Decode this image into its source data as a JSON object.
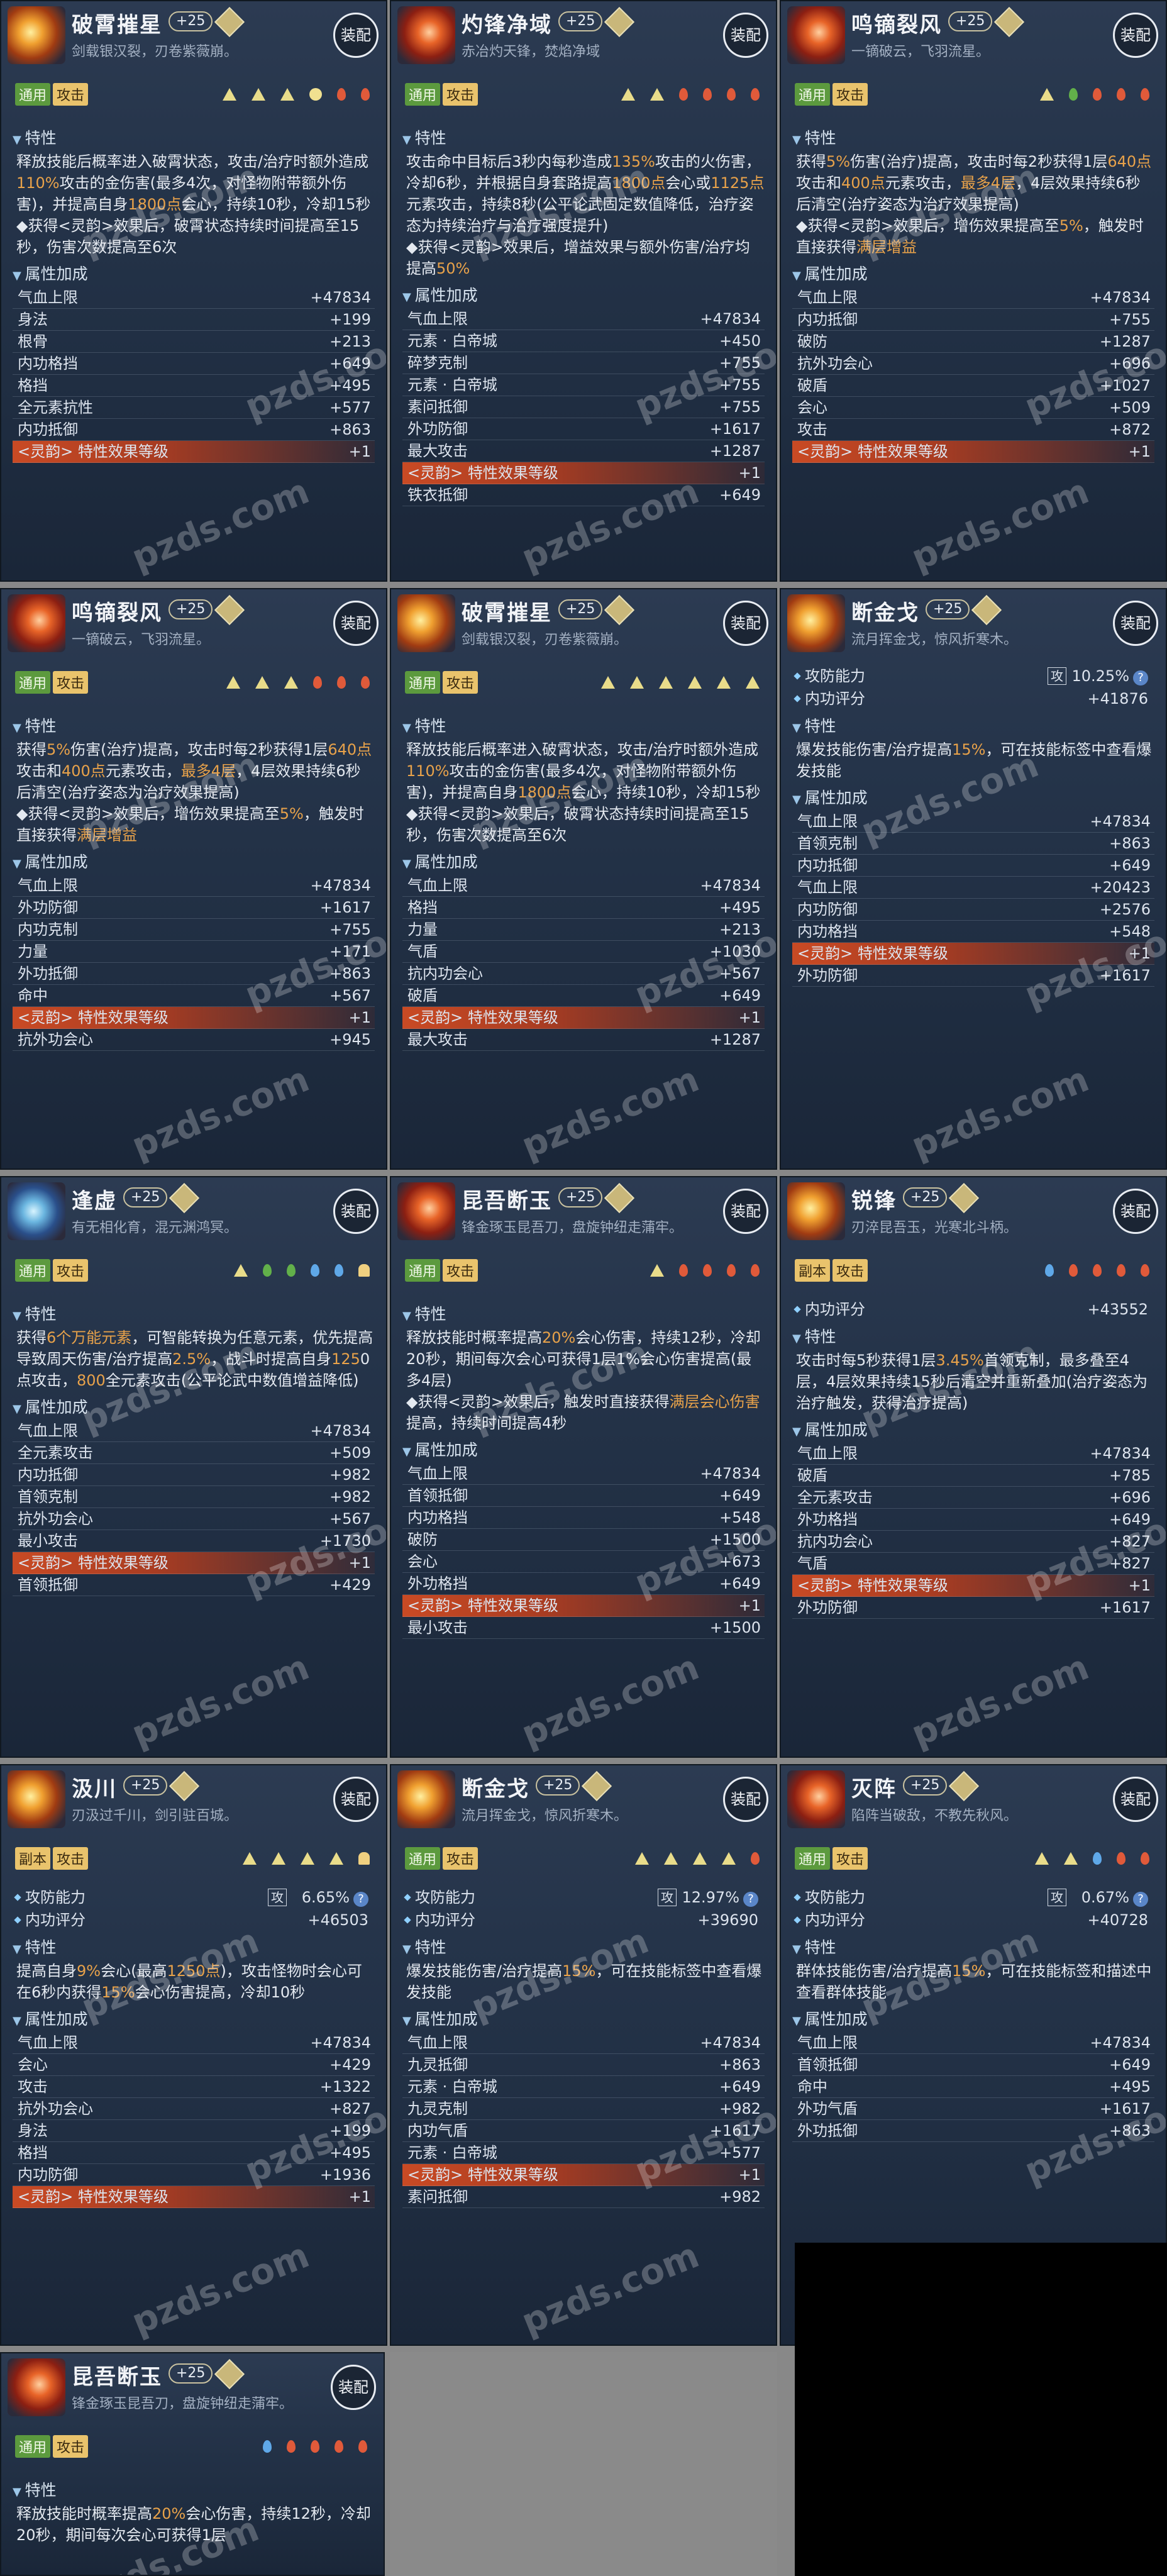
{
  "watermark": "pzds.com",
  "equip_label": "装配",
  "sections": {
    "trait": "特性",
    "attr": "属性加成"
  },
  "cards": [
    {
      "title": "破霄摧星",
      "level": "+25",
      "sub": "剑载银汉裂，刃卷紫薇崩。",
      "tags": [
        "通用",
        "攻击"
      ],
      "tagc": [
        "g",
        "y"
      ],
      "dots": [
        "tri",
        "tri",
        "tri",
        "sun",
        "red",
        "red"
      ],
      "icon": "a",
      "trait": [
        {
          "t": "释放技能后概率进入破霄状态，攻击/治疗时额外造成"
        },
        {
          "t": "110%",
          "h": 1
        },
        {
          "t": "攻击的金伤害(最多4次，对怪物附带额外伤害)，并提高自身"
        },
        {
          "t": "1800点",
          "h": 1
        },
        {
          "t": "会心，持续10秒，冷却15秒"
        },
        {
          "t": "\n◆获得<灵韵>效果后，破霄状态持续时间提高至15秒，伤害次数提高至6次"
        }
      ],
      "rows": [
        [
          "气血上限",
          "+47834"
        ],
        [
          "身法",
          "+199"
        ],
        [
          "根骨",
          "+213"
        ],
        [
          "内功格挡",
          "+649"
        ],
        [
          "格挡",
          "+495"
        ],
        [
          "全元素抗性",
          "+577"
        ],
        [
          "内功抵御",
          "+863"
        ],
        [
          "<灵韵> 特性效果等级",
          "+1",
          "s"
        ]
      ]
    },
    {
      "title": "灼锋净域",
      "level": "+25",
      "sub": "赤冶灼天锋，焚焰净域",
      "tags": [
        "通用",
        "攻击"
      ],
      "tagc": [
        "g",
        "y"
      ],
      "dots": [
        "tri",
        "tri",
        "red",
        "red",
        "red",
        "red"
      ],
      "icon": "b",
      "trait": [
        {
          "t": "攻击命中目标后3秒内每秒造成"
        },
        {
          "t": "135%",
          "h": 1
        },
        {
          "t": "攻击的火伤害，冷却6秒，并根据自身套路提高"
        },
        {
          "t": "1800点",
          "h": 1
        },
        {
          "t": "会心或"
        },
        {
          "t": "1125点",
          "h": 1
        },
        {
          "t": "元素攻击，持续8秒(公平论武固定数值降低，治疗姿态为持续治疗与治疗强度提升)"
        },
        {
          "t": "\n◆获得<灵韵>效果后，增益效果与额外伤害/治疗均提高"
        },
        {
          "t": "50%",
          "h": 1
        }
      ],
      "rows": [
        [
          "气血上限",
          "+47834"
        ],
        [
          "元素 · 白帝城",
          "+450"
        ],
        [
          "碎梦克制",
          "+755"
        ],
        [
          "元素 · 白帝城",
          "+755"
        ],
        [
          "素问抵御",
          "+755"
        ],
        [
          "外功防御",
          "+1617"
        ],
        [
          "最大攻击",
          "+1287"
        ],
        [
          "<灵韵> 特性效果等级",
          "+1",
          "s"
        ],
        [
          "铁衣抵御",
          "+649"
        ]
      ]
    },
    {
      "title": "鸣镝裂风",
      "level": "+25",
      "sub": "一镝破云，飞羽流星。",
      "tags": [
        "通用",
        "攻击"
      ],
      "tagc": [
        "g",
        "y"
      ],
      "dots": [
        "tri",
        "grn",
        "red",
        "red",
        "red"
      ],
      "icon": "b",
      "trait": [
        {
          "t": "获得"
        },
        {
          "t": "5%",
          "h": 1
        },
        {
          "t": "伤害(治疗)提高，攻击时每2秒获得1层"
        },
        {
          "t": "640点",
          "h": 1
        },
        {
          "t": "攻击和"
        },
        {
          "t": "400点",
          "h": 1
        },
        {
          "t": "元素攻击，"
        },
        {
          "t": "最多4层",
          "h": 1
        },
        {
          "t": "，4层效果持续6秒后清空(治疗姿态为治疗效果提高)"
        },
        {
          "t": "\n◆获得<灵韵>效果后，增伤效果提高至"
        },
        {
          "t": "5%",
          "h": 1
        },
        {
          "t": "，触发时直接获得"
        },
        {
          "t": "满层增益",
          "h": 1
        }
      ],
      "rows": [
        [
          "气血上限",
          "+47834"
        ],
        [
          "内功抵御",
          "+755"
        ],
        [
          "破防",
          "+1287"
        ],
        [
          "抗外功会心",
          "+696"
        ],
        [
          "破盾",
          "+1027"
        ],
        [
          "会心",
          "+509"
        ],
        [
          "攻击",
          "+872"
        ],
        [
          "<灵韵> 特性效果等级",
          "+1",
          "s"
        ]
      ]
    },
    {
      "title": "鸣镝裂风",
      "level": "+25",
      "sub": "一镝破云，飞羽流星。",
      "tags": [
        "通用",
        "攻击"
      ],
      "tagc": [
        "g",
        "y"
      ],
      "dots": [
        "tri",
        "tri",
        "tri",
        "red",
        "red",
        "red"
      ],
      "icon": "b",
      "trait": [
        {
          "t": "获得"
        },
        {
          "t": "5%",
          "h": 1
        },
        {
          "t": "伤害(治疗)提高，攻击时每2秒获得1层"
        },
        {
          "t": "640点",
          "h": 1
        },
        {
          "t": "攻击和"
        },
        {
          "t": "400点",
          "h": 1
        },
        {
          "t": "元素攻击，"
        },
        {
          "t": "最多4层",
          "h": 1
        },
        {
          "t": "，4层效果持续6秒后清空(治疗姿态为治疗效果提高)"
        },
        {
          "t": "\n◆获得<灵韵>效果后，增伤效果提高至"
        },
        {
          "t": "5%",
          "h": 1
        },
        {
          "t": "，触发时直接获得"
        },
        {
          "t": "满层增益",
          "h": 1
        }
      ],
      "rows": [
        [
          "气血上限",
          "+47834"
        ],
        [
          "外功防御",
          "+1617"
        ],
        [
          "内功克制",
          "+755"
        ],
        [
          "力量",
          "+171"
        ],
        [
          "外功抵御",
          "+863"
        ],
        [
          "命中",
          "+567"
        ],
        [
          "<灵韵> 特性效果等级",
          "+1",
          "s"
        ],
        [
          "抗外功会心",
          "+945"
        ]
      ]
    },
    {
      "title": "破霄摧星",
      "level": "+25",
      "sub": "剑载银汉裂，刃卷紫薇崩。",
      "tags": [
        "通用",
        "攻击"
      ],
      "tagc": [
        "g",
        "y"
      ],
      "dots": [
        "tri",
        "tri",
        "tri",
        "tri",
        "tri",
        "tri"
      ],
      "icon": "a",
      "trait": [
        {
          "t": "释放技能后概率进入破霄状态，攻击/治疗时额外造成"
        },
        {
          "t": "110%",
          "h": 1
        },
        {
          "t": "攻击的金伤害(最多4次，对怪物附带额外伤害)，并提高自身"
        },
        {
          "t": "1800点",
          "h": 1
        },
        {
          "t": "会心，持续10秒，冷却15秒"
        },
        {
          "t": "\n◆获得<灵韵>效果后，破霄状态持续时间提高至15秒，伤害次数提高至6次"
        }
      ],
      "rows": [
        [
          "气血上限",
          "+47834"
        ],
        [
          "格挡",
          "+495"
        ],
        [
          "力量",
          "+213"
        ],
        [
          "气盾",
          "+1030"
        ],
        [
          "抗内功会心",
          "+567"
        ],
        [
          "破盾",
          "+649"
        ],
        [
          "<灵韵> 特性效果等级",
          "+1",
          "s"
        ],
        [
          "最大攻击",
          "+1287"
        ]
      ]
    },
    {
      "title": "断金戈",
      "level": "+25",
      "sub": "流月挥金戈，惊风折寒木。",
      "tags": [],
      "tagc": [],
      "dots": [],
      "icon": "a",
      "stats": [
        {
          "l": "攻防能力",
          "ic": "攻",
          "v": "10.25%",
          "q": 1
        },
        {
          "l": "内功评分",
          "v": "+41876"
        }
      ],
      "trait": [
        {
          "t": "爆发技能伤害/治疗提高"
        },
        {
          "t": "15%",
          "h": 1
        },
        {
          "t": "，可在技能标签中查看爆发技能"
        }
      ],
      "rows": [
        [
          "气血上限",
          "+47834"
        ],
        [
          "首领克制",
          "+863"
        ],
        [
          "内功抵御",
          "+649"
        ],
        [
          "气血上限",
          "+20423"
        ],
        [
          "内功防御",
          "+2576"
        ],
        [
          "内功格挡",
          "+548"
        ],
        [
          "<灵韵> 特性效果等级",
          "+1",
          "s"
        ],
        [
          "外功防御",
          "+1617"
        ]
      ]
    },
    {
      "title": "逢虚",
      "level": "+25",
      "sub": "有无相化育，混元渊鸿冥。",
      "tags": [
        "通用",
        "攻击"
      ],
      "tagc": [
        "g",
        "y"
      ],
      "dots": [
        "tri",
        "grn",
        "grn",
        "blu",
        "blu",
        "bell"
      ],
      "icon": "c",
      "trait": [
        {
          "t": "获得"
        },
        {
          "t": "6个万能元素",
          "h": 1
        },
        {
          "t": "，可智能转换为任意元素，优先提高导致周天伤害/治疗提高"
        },
        {
          "t": "2.5%",
          "h": 1
        },
        {
          "t": "，战斗时提高自身"
        },
        {
          "t": "125",
          "h": 1
        },
        {
          "t": "0点攻击，"
        },
        {
          "t": "800",
          "h": 1
        },
        {
          "t": "全元素攻击(公平论武中数值增益降低)"
        }
      ],
      "rows": [
        [
          "气血上限",
          "+47834"
        ],
        [
          "全元素攻击",
          "+509"
        ],
        [
          "内功抵御",
          "+982"
        ],
        [
          "首领克制",
          "+982"
        ],
        [
          "抗外功会心",
          "+567"
        ],
        [
          "最小攻击",
          "+1730"
        ],
        [
          "<灵韵> 特性效果等级",
          "+1",
          "s"
        ],
        [
          "首领抵御",
          "+429"
        ]
      ]
    },
    {
      "title": "昆吾断玉",
      "level": "+25",
      "sub": "锋金琢玉昆吾刀，盘旋钟纽走蒲牢。",
      "tags": [
        "通用",
        "攻击"
      ],
      "tagc": [
        "g",
        "y"
      ],
      "dots": [
        "tri",
        "red",
        "red",
        "red",
        "red"
      ],
      "icon": "b",
      "trait": [
        {
          "t": "释放技能时概率提高"
        },
        {
          "t": "20%",
          "h": 1
        },
        {
          "t": "会心伤害，持续12秒，冷却20秒，期间每次会心可获得1层1%会心伤害提高(最多4层)"
        },
        {
          "t": "\n◆获得<灵韵>效果后，触发时直接获得"
        },
        {
          "t": "满层会心伤害",
          "h": 1
        },
        {
          "t": "提高，持续时间提高4秒"
        }
      ],
      "rows": [
        [
          "气血上限",
          "+47834"
        ],
        [
          "首领抵御",
          "+649"
        ],
        [
          "内功格挡",
          "+548"
        ],
        [
          "破防",
          "+1500"
        ],
        [
          "会心",
          "+673"
        ],
        [
          "外功格挡",
          "+649"
        ],
        [
          "<灵韵> 特性效果等级",
          "+1",
          "s"
        ],
        [
          "最小攻击",
          "+1500"
        ]
      ]
    },
    {
      "title": "锐锋",
      "level": "+25",
      "sub": "刃淬昆吾玉，光寒北斗柄。",
      "tags": [
        "副本",
        "攻击"
      ],
      "tagc": [
        "y",
        "y"
      ],
      "dots": [
        "blu",
        "red",
        "red",
        "red",
        "red"
      ],
      "icon": "a",
      "stats": [
        {
          "l": "内功评分",
          "v": "+43552"
        }
      ],
      "trait": [
        {
          "t": "攻击时每5秒获得1层"
        },
        {
          "t": "3.45%",
          "h": 1
        },
        {
          "t": "首领克制，最多叠至4层，4层效果持续15秒后清空并重新叠加(治疗姿态为治疗触发，获得治疗提高)"
        }
      ],
      "rows": [
        [
          "气血上限",
          "+47834"
        ],
        [
          "破盾",
          "+785"
        ],
        [
          "全元素攻击",
          "+696"
        ],
        [
          "外功格挡",
          "+649"
        ],
        [
          "抗内功会心",
          "+827"
        ],
        [
          "气盾",
          "+827"
        ],
        [
          "<灵韵> 特性效果等级",
          "+1",
          "s"
        ],
        [
          "外功防御",
          "+1617"
        ]
      ]
    },
    {
      "title": "汲川",
      "level": "+25",
      "sub": "刃汲过千川，剑引驻百城。",
      "tags": [
        "副本",
        "攻击"
      ],
      "tagc": [
        "y",
        "y"
      ],
      "dots": [
        "tri",
        "tri",
        "tri",
        "tri",
        "bell"
      ],
      "icon": "a",
      "stats": [
        {
          "l": "攻防能力",
          "ic": "攻",
          "v": "6.65%",
          "q": 1
        },
        {
          "l": "内功评分",
          "v": "+46503"
        }
      ],
      "trait": [
        {
          "t": "提高自身"
        },
        {
          "t": "9%",
          "h": 1
        },
        {
          "t": "会心(最高"
        },
        {
          "t": "1250点",
          "h": 1
        },
        {
          "t": ")，攻击怪物时会心可在6秒内获得"
        },
        {
          "t": "15%",
          "h": 1
        },
        {
          "t": "会心伤害提高，冷却10秒"
        }
      ],
      "rows": [
        [
          "气血上限",
          "+47834"
        ],
        [
          "会心",
          "+429"
        ],
        [
          "攻击",
          "+1322"
        ],
        [
          "抗外功会心",
          "+827"
        ],
        [
          "身法",
          "+199"
        ],
        [
          "格挡",
          "+495"
        ],
        [
          "内功防御",
          "+1936"
        ],
        [
          "<灵韵> 特性效果等级",
          "+1",
          "s"
        ]
      ]
    },
    {
      "title": "断金戈",
      "level": "+25",
      "sub": "流月挥金戈，惊风折寒木。",
      "tags": [
        "通用",
        "攻击"
      ],
      "tagc": [
        "g",
        "y"
      ],
      "dots": [
        "tri",
        "tri",
        "tri",
        "tri",
        "red"
      ],
      "icon": "a",
      "stats": [
        {
          "l": "攻防能力",
          "ic": "攻",
          "v": "12.97%",
          "q": 1
        },
        {
          "l": "内功评分",
          "v": "+39690"
        }
      ],
      "trait": [
        {
          "t": "爆发技能伤害/治疗提高"
        },
        {
          "t": "15%",
          "h": 1
        },
        {
          "t": "，可在技能标签中查看爆发技能"
        }
      ],
      "rows": [
        [
          "气血上限",
          "+47834"
        ],
        [
          "九灵抵御",
          "+863"
        ],
        [
          "元素 · 白帝城",
          "+649"
        ],
        [
          "九灵克制",
          "+982"
        ],
        [
          "内功气盾",
          "+1617"
        ],
        [
          "元素 · 白帝城",
          "+577"
        ],
        [
          "<灵韵> 特性效果等级",
          "+1",
          "s"
        ],
        [
          "素问抵御",
          "+982"
        ]
      ]
    },
    {
      "title": "灭阵",
      "level": "+25",
      "sub": "陷阵当破敌，不教先秋风。",
      "tags": [
        "通用",
        "攻击"
      ],
      "tagc": [
        "g",
        "y"
      ],
      "dots": [
        "tri",
        "tri",
        "blu",
        "red",
        "red"
      ],
      "icon": "b",
      "stats": [
        {
          "l": "攻防能力",
          "ic": "攻",
          "v": "0.67%",
          "q": 1
        },
        {
          "l": "内功评分",
          "v": "+40728"
        }
      ],
      "trait": [
        {
          "t": "群体技能伤害/治疗提高"
        },
        {
          "t": "15%",
          "h": 1
        },
        {
          "t": "，可在技能标签和描述中查看群体技能"
        }
      ],
      "rows": [
        [
          "气血上限",
          "+47834"
        ],
        [
          "首领抵御",
          "+649"
        ],
        [
          "命中",
          "+495"
        ],
        [
          "外功气盾",
          "+1617"
        ],
        [
          "外功抵御",
          "+863"
        ]
      ]
    },
    {
      "title": "昆吾断玉",
      "level": "+25",
      "sub": "锋金琢玉昆吾刀，盘旋钟纽走蒲牢。",
      "tags": [
        "通用",
        "攻击"
      ],
      "tagc": [
        "g",
        "y"
      ],
      "dots": [
        "blu",
        "red",
        "red",
        "red",
        "red"
      ],
      "icon": "b",
      "trait": [
        {
          "t": "释放技能时概率提高"
        },
        {
          "t": "20%",
          "h": 1
        },
        {
          "t": "会心伤害，持续12秒，冷却20秒，期间每次会心可获得1层"
        }
      ],
      "rows": []
    }
  ]
}
